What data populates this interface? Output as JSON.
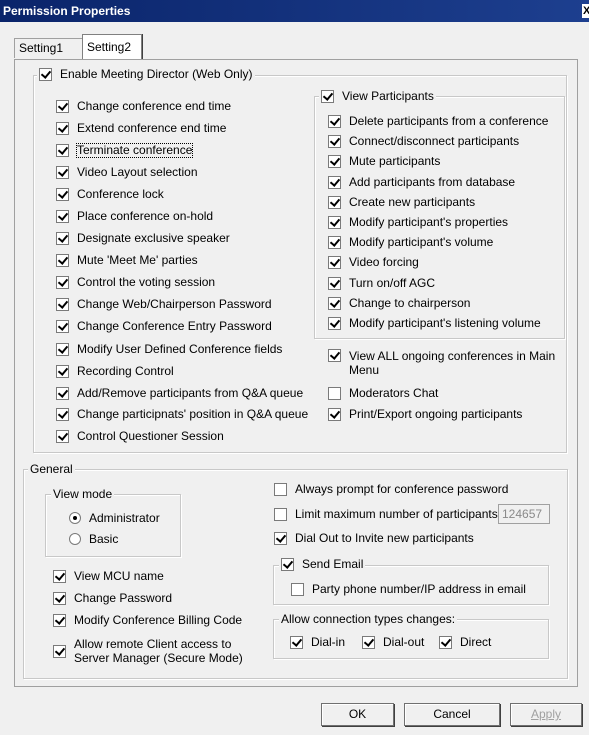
{
  "window": {
    "title": "Permission Properties",
    "close_glyph": "X"
  },
  "tabs": [
    {
      "label": "Setting1"
    },
    {
      "label": "Setting2"
    }
  ],
  "meeting_director": {
    "label": "Enable Meeting Director (Web Only)",
    "checked": true,
    "items": [
      {
        "label": "Change conference end time",
        "checked": true
      },
      {
        "label": "Extend conference end time",
        "checked": true
      },
      {
        "label": "Terminate conference",
        "checked": true
      },
      {
        "label": "Video Layout selection",
        "checked": true
      },
      {
        "label": "Conference lock",
        "checked": true
      },
      {
        "label": "Place conference on-hold",
        "checked": true
      },
      {
        "label": "Designate exclusive speaker",
        "checked": true
      },
      {
        "label": "Mute 'Meet Me' parties",
        "checked": true
      },
      {
        "label": "Control the voting session",
        "checked": true
      },
      {
        "label": "Change Web/Chairperson Password",
        "checked": true
      },
      {
        "label": "Change Conference Entry Password",
        "checked": true
      },
      {
        "label": "Modify User Defined Conference fields",
        "checked": true
      },
      {
        "label": "Recording Control",
        "checked": true
      },
      {
        "label": "Add/Remove participants from Q&A queue",
        "checked": true
      },
      {
        "label": "Change participnats' position in Q&A queue",
        "checked": true
      },
      {
        "label": "Control Questioner Session",
        "checked": true
      }
    ],
    "view_participants": {
      "label": "View Participants",
      "checked": true,
      "items": [
        {
          "label": "Delete participants from a conference",
          "checked": true
        },
        {
          "label": "Connect/disconnect participants",
          "checked": true
        },
        {
          "label": "Mute participants",
          "checked": true
        },
        {
          "label": "Add participants from database",
          "checked": true
        },
        {
          "label": "Create new participants",
          "checked": true
        },
        {
          "label": "Modify participant's properties",
          "checked": true
        },
        {
          "label": "Modify participant's volume",
          "checked": true
        },
        {
          "label": "Video forcing",
          "checked": true
        },
        {
          "label": "Turn on/off AGC",
          "checked": true
        },
        {
          "label": "Change to chairperson",
          "checked": true
        },
        {
          "label": "Modify participant's listening volume",
          "checked": true
        }
      ]
    },
    "extra": [
      {
        "label": "View ALL ongoing conferences in Main Menu",
        "checked": true
      },
      {
        "label": "Moderators Chat",
        "checked": false
      },
      {
        "label": "Print/Export ongoing participants",
        "checked": true
      }
    ]
  },
  "general": {
    "label": "General",
    "view_mode": {
      "label": "View mode",
      "options": [
        {
          "label": "Administrator",
          "selected": true
        },
        {
          "label": "Basic",
          "selected": false
        }
      ]
    },
    "left_items": [
      {
        "label": "View MCU name",
        "checked": true
      },
      {
        "label": "Change Password",
        "checked": true
      },
      {
        "label": "Modify Conference Billing Code",
        "checked": true
      },
      {
        "label": "Allow remote Client access to Server Manager (Secure Mode)",
        "checked": true
      }
    ],
    "always_prompt": {
      "label": "Always prompt for conference password",
      "checked": false
    },
    "limit_max": {
      "label": "Limit maximum number of participants",
      "checked": false,
      "value": "124657"
    },
    "dial_out": {
      "label": "Dial Out to Invite new participants",
      "checked": true
    },
    "send_email": {
      "label": "Send Email",
      "checked": true,
      "party_phone": {
        "label": "Party phone number/IP address in email",
        "checked": false
      }
    },
    "connection_types": {
      "label": "Allow connection types changes:",
      "items": [
        {
          "label": "Dial-in",
          "checked": true
        },
        {
          "label": "Dial-out",
          "checked": true
        },
        {
          "label": "Direct",
          "checked": true
        }
      ]
    }
  },
  "buttons": {
    "ok": "OK",
    "cancel": "Cancel",
    "apply": "Apply"
  }
}
